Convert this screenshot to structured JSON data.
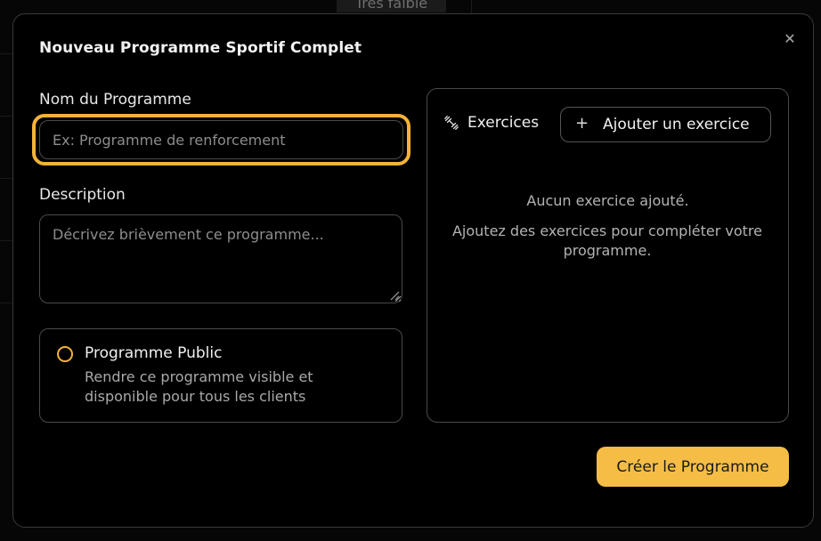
{
  "background": {
    "tab_label": "Très faible"
  },
  "modal": {
    "title": "Nouveau Programme Sportif Complet",
    "close_icon": "close-icon"
  },
  "form": {
    "name_label": "Nom du Programme",
    "name_placeholder": "Ex: Programme de renforcement",
    "name_value": "",
    "description_label": "Description",
    "description_placeholder": "Décrivez brièvement ce programme...",
    "description_value": "",
    "public_title": "Programme Public",
    "public_description": "Rendre ce programme visible et disponible pour tous les clients",
    "public_checked": false
  },
  "exercises": {
    "icon": "dumbbell-icon",
    "title": "Exercices",
    "add_button_label": "Ajouter un exercice",
    "empty_title": "Aucun exercice ajouté.",
    "empty_hint": "Ajoutez des exercices pour compléter votre programme."
  },
  "actions": {
    "create_label": "Créer le Programme"
  },
  "colors": {
    "accent": "#f5bd45",
    "focus_ring": "#f3b23b",
    "border": "#4a4a4a"
  }
}
